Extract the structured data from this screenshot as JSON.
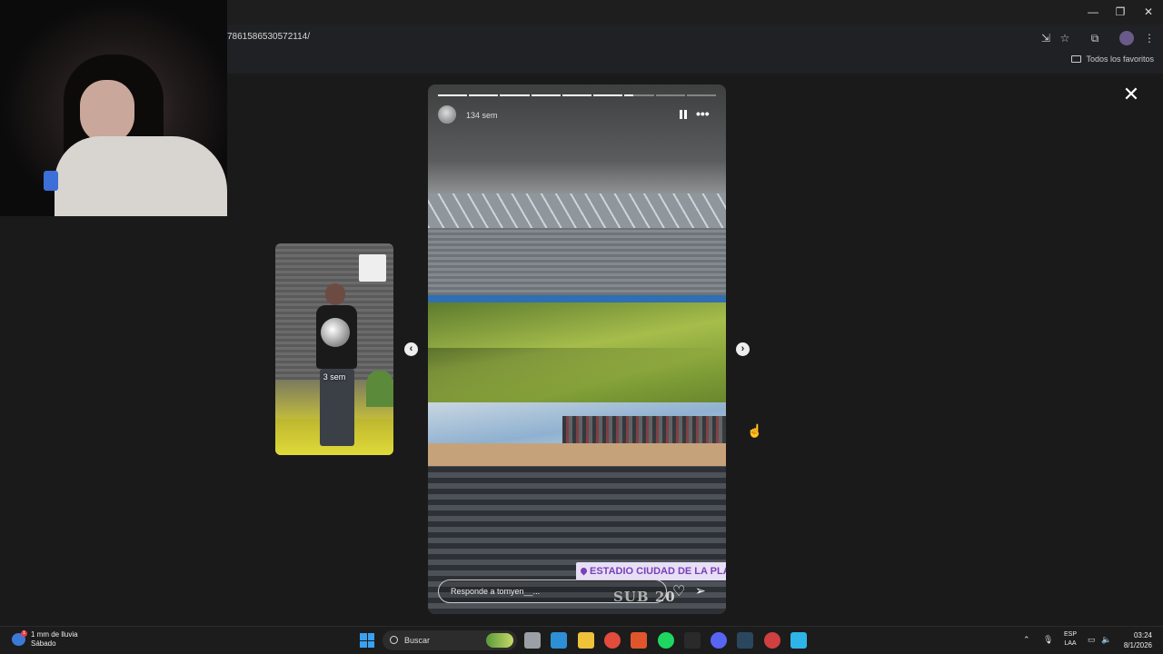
{
  "browser": {
    "url": "78615865305721​14/",
    "bookmarks_label": "Todos los favoritos",
    "win_minimize": "—",
    "win_restore": "❐",
    "win_close": "✕"
  },
  "story": {
    "time_ago": "134 sem",
    "location_sticker": "ESTADIO CIUDAD DE LA PLATA",
    "overlay_text": "SUB  20",
    "reply_placeholder": "Responde a tomyen__...",
    "progress_segments_total": 9,
    "progress_segments_done": 6,
    "progress_current_fraction": 0.3
  },
  "preview_story": {
    "time_ago": "3 sem"
  },
  "nav": {
    "prev_glyph": "‹",
    "next_glyph": "›",
    "close_glyph": "✕"
  },
  "taskbar": {
    "weather_line1": "1 mm de lluvia",
    "weather_line2": "Sábado",
    "weather_badge": "1",
    "search_label": "Buscar",
    "lang_line1": "ESP",
    "lang_line2": "LAA",
    "time": "03:24",
    "date": "8/1/2026",
    "apps": [
      "file-explorer-icon",
      "edge-icon",
      "folder-icon",
      "chrome-icon",
      "brave-icon",
      "spotify-icon",
      "epic-games-icon",
      "discord-icon",
      "steam-icon",
      "app-icon",
      "notes-icon"
    ],
    "app_colors": [
      "#9aa0a6",
      "#2d8fd6",
      "#f0c23a",
      "#e24c3c",
      "#e0562c",
      "#1ed760",
      "#2a2a2a",
      "#5865f2",
      "#2a475e",
      "#d04040",
      "#2fb4e8"
    ]
  }
}
